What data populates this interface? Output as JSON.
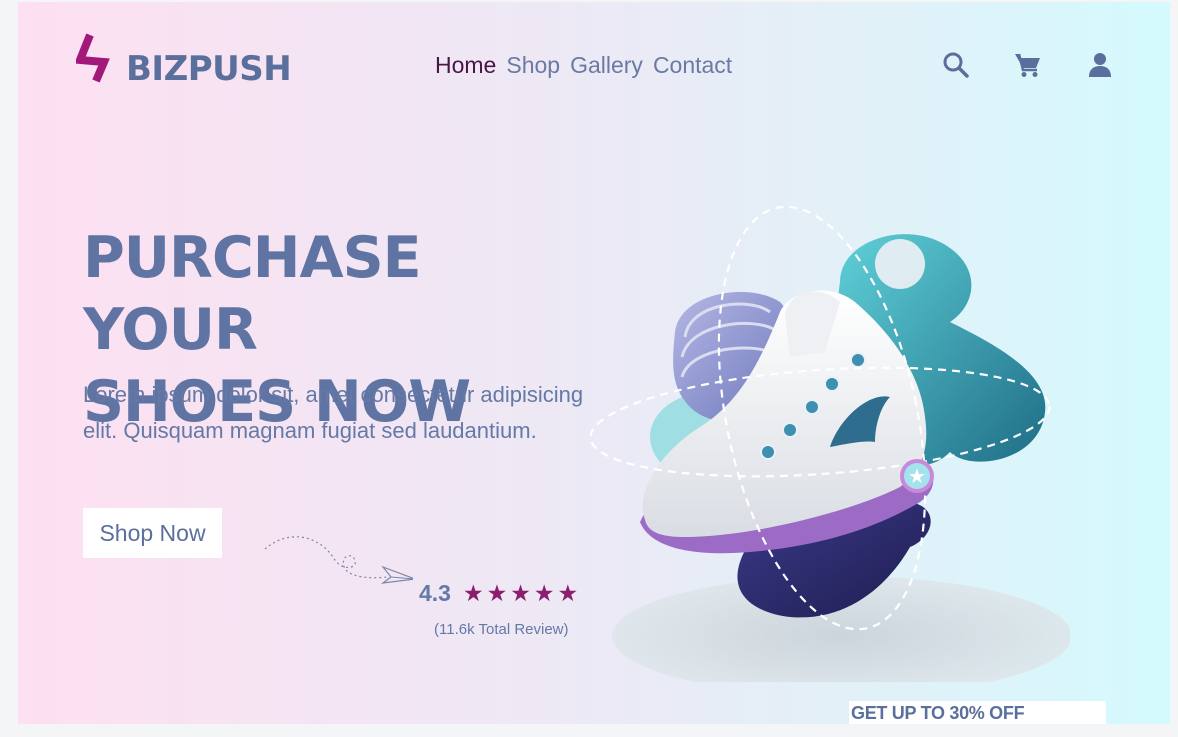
{
  "header": {
    "brand": "BIZPUSH",
    "nav": [
      {
        "label": "Home",
        "active": true
      },
      {
        "label": "Shop",
        "active": false
      },
      {
        "label": "Gallery",
        "active": false
      },
      {
        "label": "Contact",
        "active": false
      }
    ],
    "icons": [
      "search-icon",
      "cart-icon",
      "user-icon"
    ]
  },
  "hero": {
    "title_line1": "PURCHASE YOUR",
    "title_line2": "SHOES NOW",
    "description": "Lorem ipsum dolor sit, amet consectetur adipisicing elit. Quisquam magnam fugiat sed laudantium.",
    "cta_label": "Shop Now",
    "rating": {
      "value": "4.3",
      "stars": 5,
      "reviews": "(11.6k Total Review)"
    }
  },
  "promo": {
    "text": "GET UP TO 30% OFF"
  },
  "colors": {
    "brand_magenta": "#a3197a",
    "text_blue": "#5f74a2",
    "active_nav": "#4a1547",
    "star": "#8c1d6f"
  }
}
